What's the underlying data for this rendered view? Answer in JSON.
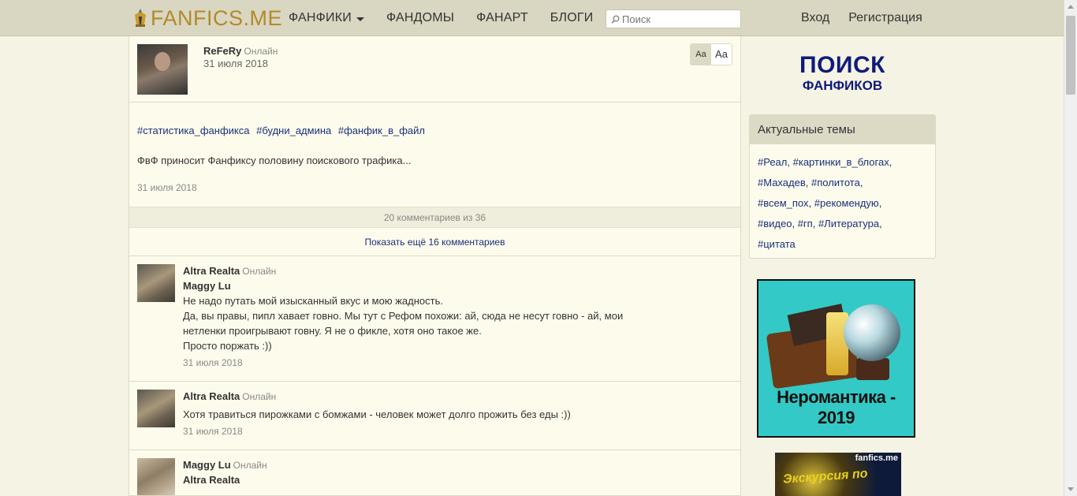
{
  "header": {
    "logo_text": "FANFICS.ME",
    "nav": [
      {
        "label": "ФАНФИКИ",
        "has_dropdown": true
      },
      {
        "label": "ФАНДОМЫ",
        "has_dropdown": false
      },
      {
        "label": "ФАНАРТ",
        "has_dropdown": false
      },
      {
        "label": "БЛОГИ",
        "has_dropdown": false
      }
    ],
    "search_placeholder": "Поиск",
    "login_label": "Вход",
    "register_label": "Регистрация"
  },
  "post": {
    "author": "ReFeRy",
    "author_status": "Онлайн",
    "date_top": "31 июля 2018",
    "font_small": "Aa",
    "font_large": "Aa",
    "tags": [
      "#статистика_фанфикса",
      "#будни_админа",
      "#фанфик_в_файл"
    ],
    "text": "ФвФ приносит Фанфиксу половину поискового трафика...",
    "date": "31 июля 2018"
  },
  "comments_meta": {
    "count_text": "20 комментариев из 36",
    "show_more": "Показать ещё 16 комментариев"
  },
  "comments": [
    {
      "author": "Altra Realta",
      "status": "Онлайн",
      "quote_name": "Maggy Lu",
      "lines": [
        "Не надо путать мой изысканный вкус и мою жадность.",
        "Да, вы правы, пипл хавает говно. Мы тут с Рефом похожи: ай, сюда не несут говно - ай, мои",
        "нетленки проигрывают говну. Я не о фикле, хотя оно такое же.",
        "Просто поржать :))"
      ],
      "date": "31 июля 2018"
    },
    {
      "author": "Altra Realta",
      "status": "Онлайн",
      "lines": [
        "Хотя травиться пирожками с бомжами - человек может долго прожить без еды :))"
      ],
      "date": "31 июля 2018"
    },
    {
      "author": "Maggy Lu",
      "status": "Онлайн",
      "quote_name": "Altra Realta"
    }
  ],
  "sidebar": {
    "search_big": "ПОИСК",
    "search_small": "ФАНФИКОВ",
    "topics_title": "Актуальные темы",
    "topics": [
      "#Реал",
      "#картинки_в_блогах",
      "#Махадев",
      "#политота",
      "#всем_пох",
      "#рекомендую",
      "#видео",
      "#гп",
      "#Литература",
      "#цитата"
    ],
    "promo1_title": "Неромантика - 2019",
    "promo2_site": "fanfics.me",
    "promo2_text": "Экскурсия по"
  },
  "colors": {
    "header_bg": "#d9d6c1",
    "page_bg": "#f5f3e3",
    "content_bg": "#fdfcec",
    "link": "#1a2f7a",
    "logo": "#b38a2a",
    "search_banner": "#0e1b7a"
  }
}
